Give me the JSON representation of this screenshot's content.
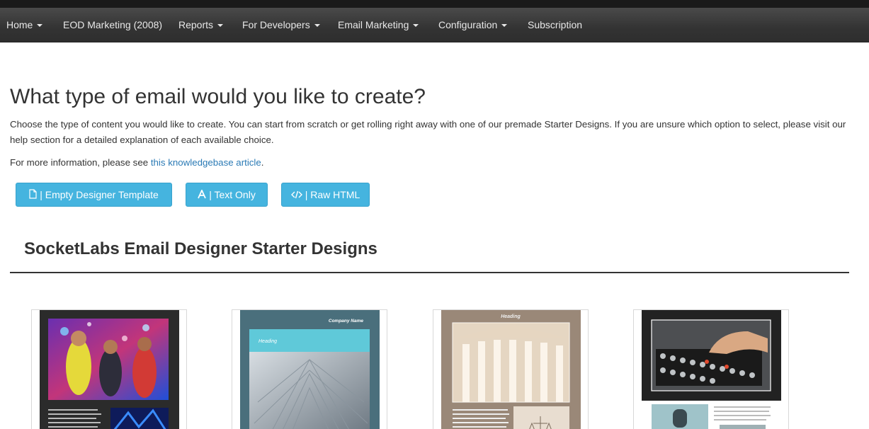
{
  "nav": {
    "items": [
      {
        "label": "Home",
        "dropdown": true
      },
      {
        "label": "EOD Marketing (2008)",
        "dropdown": false
      },
      {
        "label": "Reports",
        "dropdown": true
      },
      {
        "label": "For Developers",
        "dropdown": true
      },
      {
        "label": "Email Marketing",
        "dropdown": true
      },
      {
        "label": "Configuration",
        "dropdown": true
      },
      {
        "label": "Subscription",
        "dropdown": false
      }
    ]
  },
  "page": {
    "title": "What type of email would you like to create?",
    "description": "Choose the type of content you would like to create. You can start from scratch or get rolling right away with one of our premade Starter Designs. If you are unsure which option to select, please visit our help section for a detailed explanation of each available choice.",
    "more_info_prefix": "For more information, please see ",
    "more_info_link": "this knowledgebase article",
    "more_info_suffix": "."
  },
  "buttons": {
    "empty_designer": "| Empty Designer Template",
    "text_only": "| Text Only",
    "raw_html": "| Raw HTML"
  },
  "starter": {
    "title": "SocketLabs Email Designer Starter Designs",
    "cards": [
      {
        "heading": ""
      },
      {
        "company": "Company Name",
        "heading": "Heading"
      },
      {
        "heading": "Heading"
      },
      {
        "heading": ""
      }
    ]
  },
  "colors": {
    "button_bg": "#45b4df",
    "link": "#2a7ab5",
    "navbar": "#333333"
  },
  "icons": {
    "empty_designer": "document-icon",
    "text_only": "font-icon",
    "raw_html": "code-icon"
  }
}
